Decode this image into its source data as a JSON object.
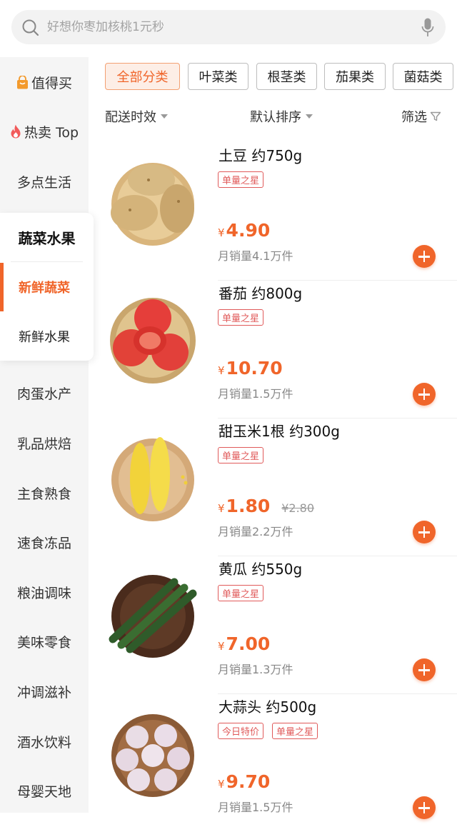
{
  "search": {
    "placeholder": "好想你枣加核桃1元秒"
  },
  "sidebar": {
    "items_top": [
      {
        "label": "值得买",
        "icon": "shopping-bag-icon"
      },
      {
        "label": "热卖 Top",
        "icon": "flame-icon"
      },
      {
        "label": "多点生活"
      }
    ],
    "group": {
      "title": "蔬菜水果",
      "subs": [
        {
          "label": "新鲜蔬菜",
          "active": true
        },
        {
          "label": "新鲜水果"
        }
      ]
    },
    "items_bottom": [
      {
        "label": "肉蛋水产"
      },
      {
        "label": "乳品烘焙"
      },
      {
        "label": "主食熟食"
      },
      {
        "label": "速食冻品"
      },
      {
        "label": "粮油调味"
      },
      {
        "label": "美味零食"
      },
      {
        "label": "冲调滋补"
      },
      {
        "label": "酒水饮料"
      },
      {
        "label": "母婴天地"
      }
    ]
  },
  "chips": [
    {
      "label": "全部分类",
      "active": true
    },
    {
      "label": "叶菜类"
    },
    {
      "label": "根茎类"
    },
    {
      "label": "茄果类"
    },
    {
      "label": "菌菇类"
    }
  ],
  "sort": {
    "delivery": "配送时效",
    "default": "默认排序",
    "filter": "筛选"
  },
  "products": [
    {
      "name": "土豆 约750g",
      "tags": [
        "单量之星"
      ],
      "currency": "¥",
      "price": "4.90",
      "sales": "月销量4.1万件",
      "image": "potato-image"
    },
    {
      "name": "番茄 约800g",
      "tags": [
        "单量之星"
      ],
      "currency": "¥",
      "price": "10.70",
      "sales": "月销量1.5万件",
      "image": "tomato-image"
    },
    {
      "name": "甜玉米1根 约300g",
      "tags": [
        "单量之星"
      ],
      "currency": "¥",
      "price": "1.80",
      "original_price": "¥2.80",
      "sales": "月销量2.2万件",
      "image": "corn-image"
    },
    {
      "name": "黄瓜 约550g",
      "tags": [
        "单量之星"
      ],
      "currency": "¥",
      "price": "7.00",
      "sales": "月销量1.3万件",
      "image": "cucumber-image"
    },
    {
      "name": "大蒜头 约500g",
      "tags": [
        "今日特价",
        "单量之星"
      ],
      "currency": "¥",
      "price": "9.70",
      "sales": "月销量1.5万件",
      "image": "garlic-image"
    }
  ],
  "colors": {
    "accent": "#f0652a",
    "tag": "#e05a5a",
    "sidebar_bg": "#f5f5f5"
  }
}
